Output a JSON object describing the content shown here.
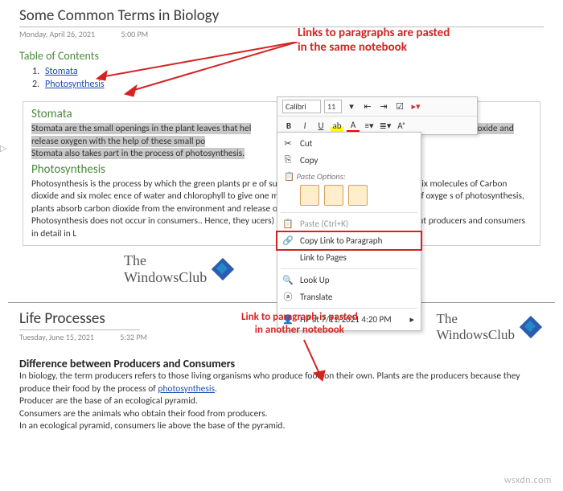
{
  "page1": {
    "title": "Some Common Terms in Biology",
    "date": "Monday, April 26, 2021",
    "time": "5:00 PM",
    "toc_head": "Table of Contents",
    "toc": [
      {
        "n": "1.",
        "label": "Stomata"
      },
      {
        "n": "2.",
        "label": "Photosynthesis"
      }
    ],
    "annotation": "Links to paragraphs are pasted\nin the same notebook",
    "stomata_head": "Stomata",
    "stomata_body_sel": "Stomata are the small openings in the plant leaves that hel",
    "stomata_body_sel2": "The plants take in carbon dioxide and release oxygen with the help of these small po",
    "stomata_body_sel3": "Stomata also takes part in the process of photosynthesis.",
    "photo_head": "Photosynthesis",
    "photo_body": "Photosynthesis is the process by which the green plants pr                                                       e of sunlight and water. During this process, six molecules of Carbon dioxide and six molec                                                    ence of water and chlorophyll to give one molecule of glucose and six molecules of oxyge                                                     s of photosynthesis, plants absorb carbon dioxide from the environment and release o",
    "photo_body2": "Photosynthesis does not occur in consumers.. Hence, they                                                        ucers) to obtain their food. You can read about producers and consumers in detail in L"
  },
  "toolbar": {
    "font": "Calibri",
    "size": "11"
  },
  "ctx": {
    "cut": "Cut",
    "copy": "Copy",
    "paste_label": "Paste Options:",
    "paste": "Paste (Ctrl+K)",
    "copy_link": "Copy Link to Paragraph",
    "link_pages": "Link to Pages",
    "lookup": "Look Up",
    "translate": "Translate",
    "hp": "HP at 7/11/2021 4:20 PM"
  },
  "logo": {
    "line1": "The",
    "line2": "WindowsClub"
  },
  "page2": {
    "title": "Life Processes",
    "date": "Tuesday, June 15, 2021",
    "time": "5:32 PM",
    "annotation": "Link to paragraph is pasted\nin another notebook",
    "h": "Difference between Producers and Consumers",
    "b1": "In biology, the term producers refers to those living organisms who produce food on their own. Plants are the producers because they produce their food by the process of ",
    "link": "photosynthesis",
    "b1b": ".",
    "b2": "Producer are the base of an ecological pyramid.",
    "b3": "Consumers are the animals who obtain their food from producers.",
    "b4": "In an ecological pyramid, consumers lie above the base of the pyramid."
  },
  "watermark": "wsxdn.com"
}
